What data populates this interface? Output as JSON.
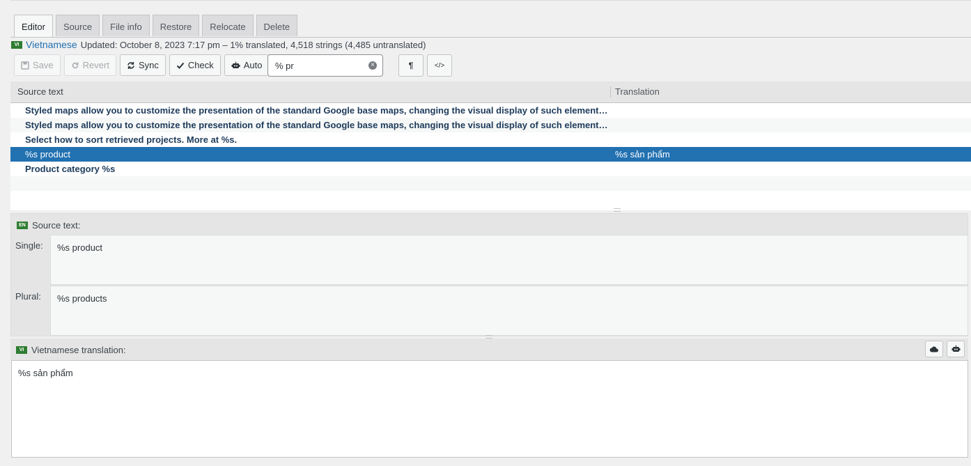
{
  "tabs": [
    {
      "label": "Editor",
      "active": true
    },
    {
      "label": "Source"
    },
    {
      "label": "File info"
    },
    {
      "label": "Restore"
    },
    {
      "label": "Relocate"
    },
    {
      "label": "Delete"
    }
  ],
  "status": {
    "flag": "VI",
    "language": "Vietnamese",
    "text": "Updated: October 8, 2023 7:17 pm – 1% translated, 4,518 strings (4,485 untranslated)"
  },
  "toolbar": {
    "save": "Save",
    "revert": "Revert",
    "sync": "Sync",
    "check": "Check",
    "auto": "Auto",
    "search_value": "% pr",
    "pilcrow": "¶",
    "code": "</>"
  },
  "grid": {
    "headers": {
      "source": "Source text",
      "translation": "Translation"
    },
    "rows": [
      {
        "source": "Styled maps allow you to customize the presentation of the standard Google base maps, changing the visual display of such elements as roads, parks, and built-up areas.",
        "translation": ""
      },
      {
        "source": "Styled maps allow you to customize the presentation of the standard Google base maps, changing the visual display of such elements as roads, parks, and built-up areas.",
        "translation": ""
      },
      {
        "source": "Select how to sort retrieved projects. More at %s.",
        "translation": ""
      },
      {
        "source": "%s product",
        "translation": "%s sản phẩm",
        "selected": true
      },
      {
        "source": "Product category %s",
        "translation": ""
      }
    ]
  },
  "source_panel": {
    "flag": "EN",
    "title": "Source text:",
    "single_label": "Single:",
    "single_value": "%s product",
    "plural_label": "Plural:",
    "plural_value": "%s products"
  },
  "translation_panel": {
    "flag": "VI",
    "title": "Vietnamese translation:",
    "value": "%s sản phẩm"
  },
  "colors": {
    "selected_row": "#2271b1",
    "link": "#2271b1",
    "flag_green": "#2f7d32"
  }
}
